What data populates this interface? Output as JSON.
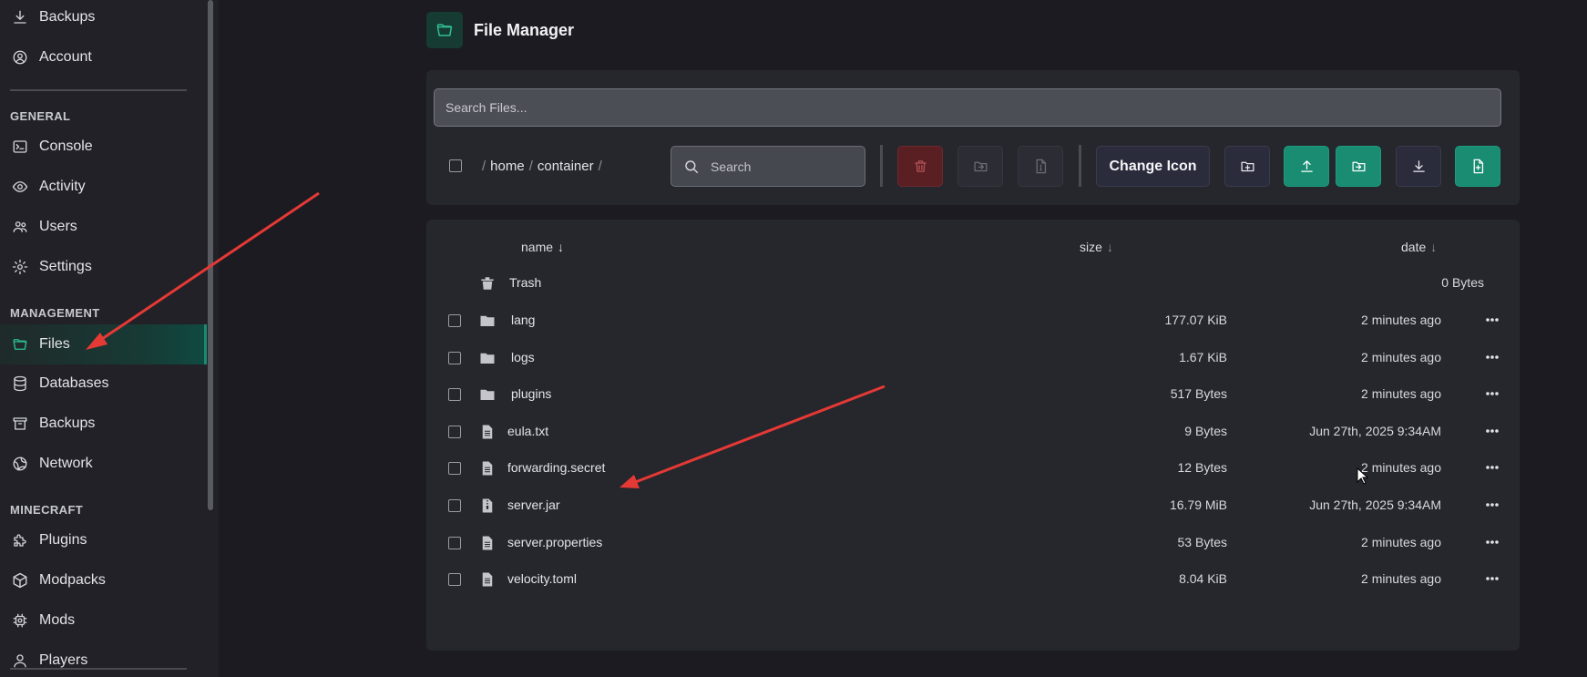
{
  "sidebar": {
    "top_items": [
      {
        "label": "Backups",
        "icon": "download-icon"
      },
      {
        "label": "Account",
        "icon": "user-circle-icon"
      }
    ],
    "sections": [
      {
        "title": "GENERAL",
        "items": [
          {
            "label": "Console",
            "icon": "terminal-icon"
          },
          {
            "label": "Activity",
            "icon": "eye-icon"
          },
          {
            "label": "Users",
            "icon": "users-icon"
          },
          {
            "label": "Settings",
            "icon": "gear-icon"
          }
        ]
      },
      {
        "title": "MANAGEMENT",
        "items": [
          {
            "label": "Files",
            "icon": "folder-icon",
            "active": true
          },
          {
            "label": "Databases",
            "icon": "database-icon"
          },
          {
            "label": "Backups",
            "icon": "archive-icon"
          },
          {
            "label": "Network",
            "icon": "globe-icon"
          }
        ]
      },
      {
        "title": "MINECRAFT",
        "items": [
          {
            "label": "Plugins",
            "icon": "puzzle-icon"
          },
          {
            "label": "Modpacks",
            "icon": "cube-icon"
          },
          {
            "label": "Mods",
            "icon": "cog-chip-icon"
          },
          {
            "label": "Players",
            "icon": "user-icon"
          }
        ]
      }
    ]
  },
  "header": {
    "title": "File Manager",
    "icon": "folder-icon"
  },
  "toolbar": {
    "search_files_placeholder": "Search Files...",
    "breadcrumb": [
      "home",
      "container"
    ],
    "search_placeholder": "Search",
    "change_icon_label": "Change Icon"
  },
  "columns": {
    "name": "name",
    "size": "size",
    "date": "date",
    "sort_arrow": "↓"
  },
  "trash": {
    "name": "Trash",
    "size": "0 Bytes"
  },
  "files": [
    {
      "name": "lang",
      "type": "folder",
      "size": "177.07 KiB",
      "date": "2 minutes ago"
    },
    {
      "name": "logs",
      "type": "folder",
      "size": "1.67 KiB",
      "date": "2 minutes ago"
    },
    {
      "name": "plugins",
      "type": "folder",
      "size": "517 Bytes",
      "date": "2 minutes ago"
    },
    {
      "name": "eula.txt",
      "type": "file",
      "size": "9 Bytes",
      "date": "Jun 27th, 2025 9:34AM"
    },
    {
      "name": "forwarding.secret",
      "type": "file",
      "size": "12 Bytes",
      "date": "2 minutes ago"
    },
    {
      "name": "server.jar",
      "type": "archive",
      "size": "16.79 MiB",
      "date": "Jun 27th, 2025 9:34AM"
    },
    {
      "name": "server.properties",
      "type": "file",
      "size": "53 Bytes",
      "date": "2 minutes ago"
    },
    {
      "name": "velocity.toml",
      "type": "file",
      "size": "8.04 KiB",
      "date": "2 minutes ago"
    }
  ],
  "colors": {
    "accent": "#198c72",
    "danger": "#5a1f22",
    "annotation": "#e53935"
  }
}
